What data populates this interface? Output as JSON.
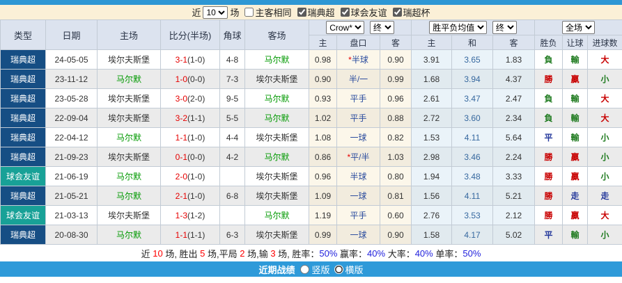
{
  "filter_bar": {
    "near_label": "近",
    "count_select": {
      "value": "10",
      "options": [
        "10"
      ]
    },
    "matches_label": "场",
    "same_checkbox": {
      "label": "主客相同",
      "checked": false
    },
    "league_checkboxes": [
      {
        "label": "瑞典超",
        "checked": true
      },
      {
        "label": "球会友谊",
        "checked": true
      },
      {
        "label": "瑞超杯",
        "checked": true
      }
    ]
  },
  "header": {
    "static_columns": [
      "类型",
      "日期",
      "主场",
      "比分(半场)",
      "角球",
      "客场"
    ],
    "asia_group": {
      "selects": [
        "Crow*",
        "终"
      ],
      "columns": [
        "主",
        "盘口",
        "客"
      ]
    },
    "europe_group": {
      "selects": [
        "胜平负均值",
        "终"
      ],
      "columns": [
        "主",
        "和",
        "客"
      ]
    },
    "result_group": {
      "selects": [
        "全场"
      ],
      "columns": [
        "胜负",
        "让球",
        "进球数"
      ]
    }
  },
  "table": {
    "rows": [
      {
        "league": "瑞典超",
        "league_color": "navy",
        "date": "24-05-05",
        "home": {
          "text": "埃尔夫斯堡",
          "green": false
        },
        "score": {
          "main": "3-1",
          "half": "(1-0)"
        },
        "corner": "4-8",
        "away": {
          "text": "马尔默",
          "green": true
        },
        "asia": {
          "home": "0.98",
          "star": true,
          "handicap": "半球",
          "away": "0.90"
        },
        "europe": {
          "home": "3.91",
          "draw": "3.65",
          "away": "1.83"
        },
        "outcome": {
          "text": "負",
          "color": "green"
        },
        "handicap_result": {
          "text": "輸",
          "color": "green"
        },
        "goals_result": {
          "text": "大",
          "color": "red"
        }
      },
      {
        "league": "瑞典超",
        "league_color": "navy",
        "date": "23-11-12",
        "home": {
          "text": "马尔默",
          "green": true
        },
        "score": {
          "main": "1-0",
          "half": "(0-0)"
        },
        "corner": "7-3",
        "away": {
          "text": "埃尔夫斯堡",
          "green": false
        },
        "asia": {
          "home": "0.90",
          "star": false,
          "handicap": "半/一",
          "away": "0.99"
        },
        "europe": {
          "home": "1.68",
          "draw": "3.94",
          "away": "4.37"
        },
        "outcome": {
          "text": "勝",
          "color": "red"
        },
        "handicap_result": {
          "text": "贏",
          "color": "red"
        },
        "goals_result": {
          "text": "小",
          "color": "green"
        }
      },
      {
        "league": "瑞典超",
        "league_color": "navy",
        "date": "23-05-28",
        "home": {
          "text": "埃尔夫斯堡",
          "green": false
        },
        "score": {
          "main": "3-0",
          "half": "(2-0)"
        },
        "corner": "9-5",
        "away": {
          "text": "马尔默",
          "green": true
        },
        "asia": {
          "home": "0.93",
          "star": false,
          "handicap": "平手",
          "away": "0.96"
        },
        "europe": {
          "home": "2.61",
          "draw": "3.47",
          "away": "2.47"
        },
        "outcome": {
          "text": "負",
          "color": "green"
        },
        "handicap_result": {
          "text": "輸",
          "color": "green"
        },
        "goals_result": {
          "text": "大",
          "color": "red"
        }
      },
      {
        "league": "瑞典超",
        "league_color": "navy",
        "date": "22-09-04",
        "home": {
          "text": "埃尔夫斯堡",
          "green": false
        },
        "score": {
          "main": "3-2",
          "half": "(1-1)"
        },
        "corner": "5-5",
        "away": {
          "text": "马尔默",
          "green": true
        },
        "asia": {
          "home": "1.02",
          "star": false,
          "handicap": "平手",
          "away": "0.88"
        },
        "europe": {
          "home": "2.72",
          "draw": "3.60",
          "away": "2.34"
        },
        "outcome": {
          "text": "負",
          "color": "green"
        },
        "handicap_result": {
          "text": "輸",
          "color": "green"
        },
        "goals_result": {
          "text": "大",
          "color": "red"
        }
      },
      {
        "league": "瑞典超",
        "league_color": "navy",
        "date": "22-04-12",
        "home": {
          "text": "马尔默",
          "green": true
        },
        "score": {
          "main": "1-1",
          "half": "(1-0)"
        },
        "corner": "4-4",
        "away": {
          "text": "埃尔夫斯堡",
          "green": false
        },
        "asia": {
          "home": "1.08",
          "star": false,
          "handicap": "一球",
          "away": "0.82"
        },
        "europe": {
          "home": "1.53",
          "draw": "4.11",
          "away": "5.64"
        },
        "outcome": {
          "text": "平",
          "color": "blue"
        },
        "handicap_result": {
          "text": "輸",
          "color": "green"
        },
        "goals_result": {
          "text": "小",
          "color": "green"
        }
      },
      {
        "league": "瑞典超",
        "league_color": "navy",
        "date": "21-09-23",
        "home": {
          "text": "埃尔夫斯堡",
          "green": false
        },
        "score": {
          "main": "0-1",
          "half": "(0-0)"
        },
        "corner": "4-2",
        "away": {
          "text": "马尔默",
          "green": true
        },
        "asia": {
          "home": "0.86",
          "star": true,
          "handicap": "平/半",
          "away": "1.03"
        },
        "europe": {
          "home": "2.98",
          "draw": "3.46",
          "away": "2.24"
        },
        "outcome": {
          "text": "勝",
          "color": "red"
        },
        "handicap_result": {
          "text": "贏",
          "color": "red"
        },
        "goals_result": {
          "text": "小",
          "color": "green"
        }
      },
      {
        "league": "球会友谊",
        "league_color": "teal",
        "date": "21-06-19",
        "home": {
          "text": "马尔默",
          "green": true
        },
        "score": {
          "main": "2-0",
          "half": "(1-0)"
        },
        "corner": "",
        "away": {
          "text": "埃尔夫斯堡",
          "green": false
        },
        "asia": {
          "home": "0.96",
          "star": false,
          "handicap": "半球",
          "away": "0.80"
        },
        "europe": {
          "home": "1.94",
          "draw": "3.48",
          "away": "3.33"
        },
        "outcome": {
          "text": "勝",
          "color": "red"
        },
        "handicap_result": {
          "text": "贏",
          "color": "red"
        },
        "goals_result": {
          "text": "小",
          "color": "green"
        }
      },
      {
        "league": "瑞典超",
        "league_color": "navy",
        "date": "21-05-21",
        "home": {
          "text": "马尔默",
          "green": true
        },
        "score": {
          "main": "2-1",
          "half": "(1-0)"
        },
        "corner": "6-8",
        "away": {
          "text": "埃尔夫斯堡",
          "green": false
        },
        "asia": {
          "home": "1.09",
          "star": false,
          "handicap": "一球",
          "away": "0.81"
        },
        "europe": {
          "home": "1.56",
          "draw": "4.11",
          "away": "5.21"
        },
        "outcome": {
          "text": "勝",
          "color": "red"
        },
        "handicap_result": {
          "text": "走",
          "color": "blue"
        },
        "goals_result": {
          "text": "走",
          "color": "blue"
        }
      },
      {
        "league": "球会友谊",
        "league_color": "teal",
        "date": "21-03-13",
        "home": {
          "text": "埃尔夫斯堡",
          "green": false
        },
        "score": {
          "main": "1-3",
          "half": "(1-2)"
        },
        "corner": "",
        "away": {
          "text": "马尔默",
          "green": true
        },
        "asia": {
          "home": "1.19",
          "star": false,
          "handicap": "平手",
          "away": "0.60"
        },
        "europe": {
          "home": "2.76",
          "draw": "3.53",
          "away": "2.12"
        },
        "outcome": {
          "text": "勝",
          "color": "red"
        },
        "handicap_result": {
          "text": "贏",
          "color": "red"
        },
        "goals_result": {
          "text": "大",
          "color": "red"
        }
      },
      {
        "league": "瑞典超",
        "league_color": "navy",
        "date": "20-08-30",
        "home": {
          "text": "马尔默",
          "green": true
        },
        "score": {
          "main": "1-1",
          "half": "(1-1)"
        },
        "corner": "6-3",
        "away": {
          "text": "埃尔夫斯堡",
          "green": false
        },
        "asia": {
          "home": "0.99",
          "star": false,
          "handicap": "一球",
          "away": "0.90"
        },
        "europe": {
          "home": "1.58",
          "draw": "4.17",
          "away": "5.02"
        },
        "outcome": {
          "text": "平",
          "color": "blue"
        },
        "handicap_result": {
          "text": "輸",
          "color": "green"
        },
        "goals_result": {
          "text": "小",
          "color": "green"
        }
      }
    ]
  },
  "summary": {
    "segments": [
      {
        "t": "近 ",
        "c": "k"
      },
      {
        "t": "10",
        "c": "r"
      },
      {
        "t": " 场, 胜出 ",
        "c": "k"
      },
      {
        "t": "5",
        "c": "r"
      },
      {
        "t": " 场,平局 ",
        "c": "k"
      },
      {
        "t": "2",
        "c": "r"
      },
      {
        "t": " 场,输 ",
        "c": "k"
      },
      {
        "t": "3",
        "c": "r"
      },
      {
        "t": " 场, 胜率：",
        "c": "k"
      },
      {
        "t": "50%",
        "c": "b"
      },
      {
        "t": " 赢率：",
        "c": "k"
      },
      {
        "t": "40%",
        "c": "b"
      },
      {
        "t": " 大率：",
        "c": "k"
      },
      {
        "t": "40%",
        "c": "b"
      },
      {
        "t": " 单率：",
        "c": "k"
      },
      {
        "t": "50%",
        "c": "b"
      }
    ]
  },
  "footer": {
    "title": "近期战绩",
    "options": [
      {
        "label": "竖版",
        "checked": false
      },
      {
        "label": "横版",
        "checked": true
      }
    ]
  },
  "colors": {
    "topbar_blue": "#2E97D4",
    "footer_blue": "#2E9AD9",
    "filter_cream": "#FBF0D7",
    "header_bg": "#DCE3EF",
    "league_navy": "#164E84",
    "friendly_teal": "#18A197",
    "score_red": "#E60000",
    "team_green": "#009900",
    "result_red": "#C80000",
    "result_green": "#1E7A1E",
    "result_blue": "#23379B",
    "draw_odds_blue": "#36689F",
    "summary_num_red": "#FF0000",
    "summary_pct_blue": "#2222DD"
  }
}
